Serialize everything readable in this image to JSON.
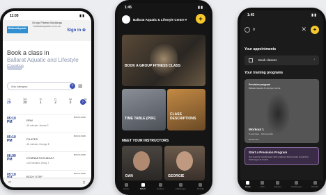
{
  "phone1": {
    "status_time": "11:03",
    "header_title": "Group Fitness Bookings",
    "header_url": "ballarataquatic.com.au",
    "logo_text": "BallaratAquatic",
    "sign_in": "Sign in",
    "book_title": "Book a class in",
    "venue": "Ballarat Aquatic and Lifestyle Centre",
    "category_placeholder": "Any category",
    "days": [
      {
        "dow": "Tu",
        "num": "29"
      },
      {
        "dow": "We",
        "num": "30"
      },
      {
        "dow": "Th",
        "num": "1"
      },
      {
        "dow": "Fr",
        "num": "2"
      },
      {
        "dow": "Sa",
        "num": "3"
      },
      {
        "dow": "Su",
        "num": "4"
      }
    ],
    "classes": [
      {
        "time": "05:10 PM",
        "name": "RPM",
        "duration": "45 minutes",
        "instructor": "James E",
        "book": "BOOK NOW"
      },
      {
        "time": "05:10 PM",
        "name": "PILATES",
        "duration": "45 minutes",
        "instructor": "George E",
        "book": "BOOK NOW"
      },
      {
        "time": "06:00 PM",
        "name": "GYMNASTICS ADULT",
        "duration": "120 minutes",
        "instructor": "Jenny T",
        "book": "BOOK NOW"
      },
      {
        "time": "05:10 PM",
        "name": "BODY STEP",
        "duration": "",
        "instructor": "",
        "book": "BOOK NOW"
      }
    ]
  },
  "phone2": {
    "status_time": "1:45",
    "venue": "Ballarat Aquatic & Lifestyle Centre",
    "book_card": "BOOK A GROUP FITNESS CLASS",
    "timetable_card": "TIME TABLE (PDF)",
    "descriptions_card": "CLASS DESCRIPTIONS",
    "instructors_title": "MEET YOUR INSTRUCTORS",
    "instructors": [
      "DAN",
      "GEORGIE"
    ],
    "tabs": [
      "Home",
      "BALC",
      "Explore",
      "Challenges",
      "Results"
    ]
  },
  "phone3": {
    "status_time": "1:45",
    "count": "0",
    "appointments_title": "Your appointments",
    "book_classes": "Book classes",
    "programs_title": "Your training programs",
    "program_tag": "Precision program",
    "program_sub": "Ballarat Aquatic & Lifestyle Centre",
    "workout_title": "Workout 1",
    "workout_meta": "5 exercises · 140 seconds",
    "workout_time": "00:46 mins",
    "start_title": "Start a Precision Program",
    "start_sub": "Get superior results faster with a tailored training plan created by Technogym & Coach",
    "tabs": [
      "Home",
      "Plan",
      "Explore",
      "Challenges",
      "Results"
    ]
  },
  "colors": {
    "accent_yellow": "#f6c82b",
    "brand_blue": "#3f51b5"
  }
}
